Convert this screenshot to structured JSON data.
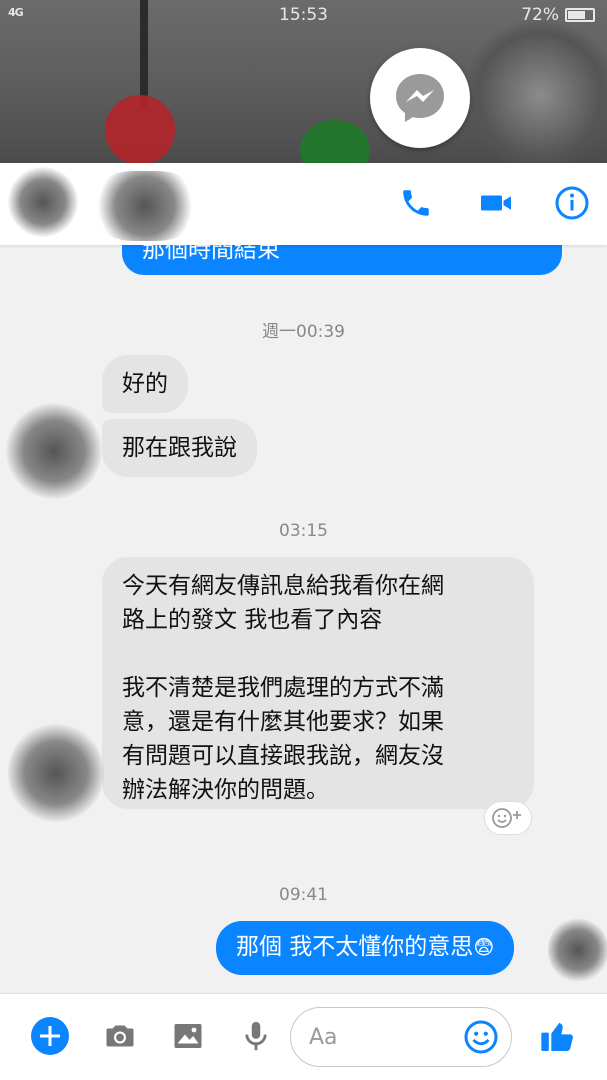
{
  "status_bar": {
    "signal": "4G",
    "time": "15:53",
    "battery": "72%",
    "battery_level": 0.72
  },
  "header": {
    "call_icon": "phone-icon",
    "video_icon": "video-camera-icon",
    "info_icon": "info-icon"
  },
  "messages": {
    "top_partial": "那個時間結束",
    "ts1": "週一00:39",
    "in1": "好的",
    "in2": "那在跟我說",
    "ts2": "03:15",
    "in3_p1_l1": "今天有網友傳訊息給我看你在網",
    "in3_p1_l2": "路上的發文  我也看了內容",
    "in3_p2_l1": "我不清楚是我們處理的方式不滿",
    "in3_p2_l2": "意，還是有什麼其他要求？如果",
    "in3_p2_l3": "有問題可以直接跟我說，網友沒",
    "in3_p2_l4": "辦法解決你的問題。",
    "ts3": "09:41",
    "out1": "那個 我不太懂你的意思",
    "out1_emoji": "😨"
  },
  "composer": {
    "placeholder": "Aa",
    "icons": [
      "plus-icon",
      "camera-icon",
      "image-icon",
      "microphone-icon",
      "emoji-icon",
      "thumbs-up-icon"
    ]
  },
  "colors": {
    "accent": "#0a84ff",
    "incoming_bubble": "#e4e4e4",
    "timestamp": "#888888"
  }
}
